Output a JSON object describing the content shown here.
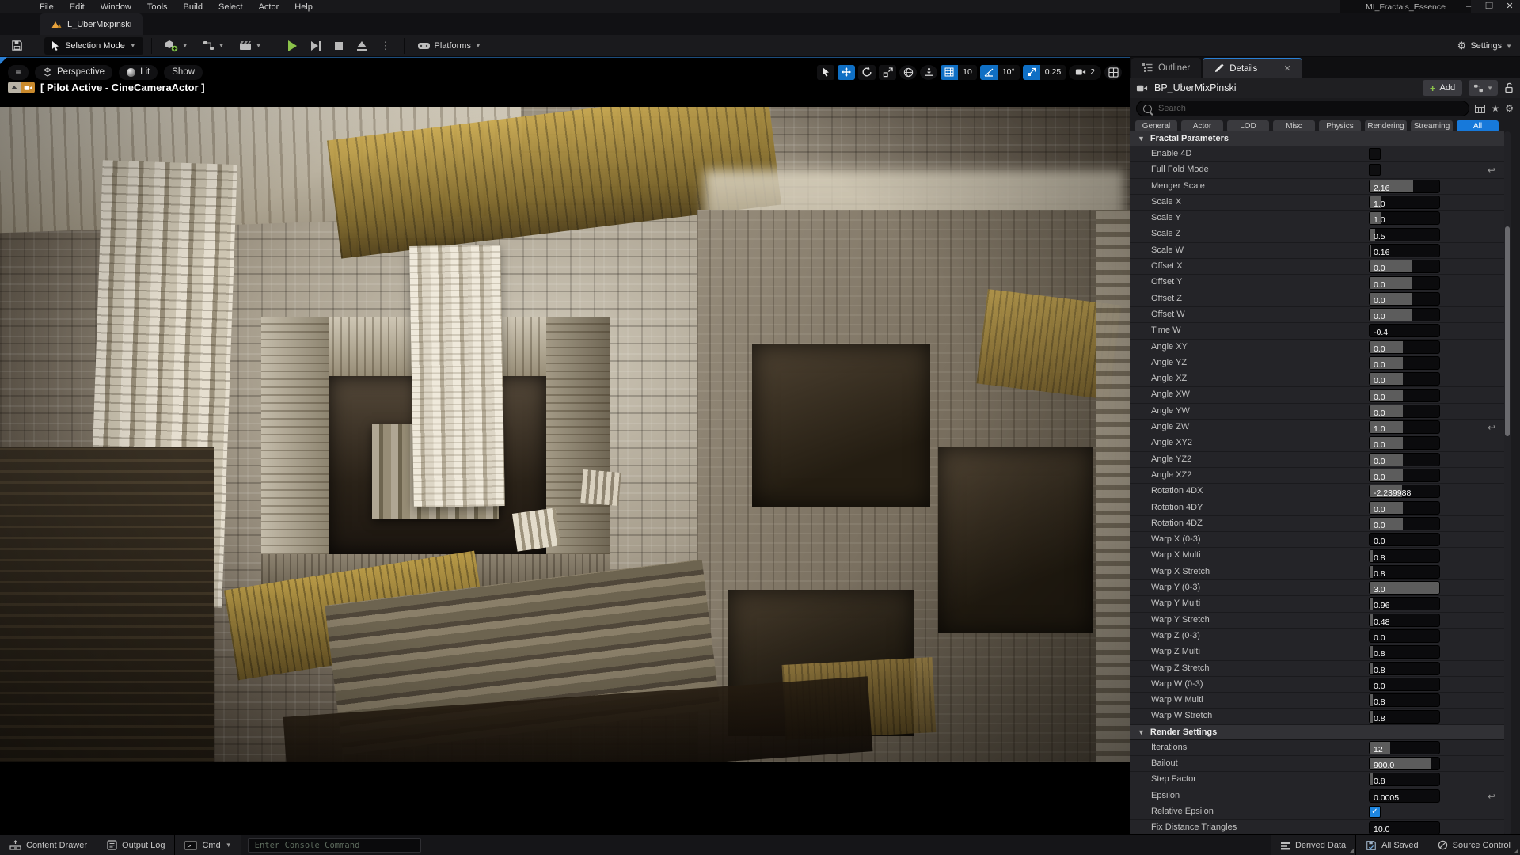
{
  "window": {
    "title": "MI_Fractals_Essence",
    "minimize": "–",
    "maximize": "❐",
    "close": "✕"
  },
  "menubar": {
    "menus": [
      "File",
      "Edit",
      "Window",
      "Tools",
      "Build",
      "Select",
      "Actor",
      "Help"
    ]
  },
  "level_tab": {
    "label": "L_UberMixpinski"
  },
  "toolbar": {
    "selection_mode": "Selection Mode",
    "platforms": "Platforms",
    "settings": "Settings"
  },
  "viewport": {
    "perspective": "Perspective",
    "lit": "Lit",
    "show": "Show",
    "pilot_label": "[ Pilot Active - CineCameraActor ]",
    "snaps": {
      "grid": "10",
      "rotation": "10°",
      "scale": "0.25",
      "camera_speed": "2"
    }
  },
  "details_panel": {
    "tabs": {
      "outliner": "Outliner",
      "details": "Details"
    },
    "object_name": "BP_UberMixPinski",
    "add_button": "Add",
    "search_placeholder": "Search",
    "filters": [
      "General",
      "Actor",
      "LOD",
      "Misc",
      "Physics",
      "Rendering",
      "Streaming",
      "All"
    ],
    "active_filter": "All",
    "sections": [
      {
        "title": "Fractal Parameters",
        "rows": [
          {
            "label": "Enable 4D",
            "type": "checkbox",
            "checked": false,
            "reset": false
          },
          {
            "label": "Full Fold Mode",
            "type": "checkbox",
            "checked": false,
            "reset": true
          },
          {
            "label": "Menger Scale",
            "type": "slider",
            "value": "2.16",
            "fill": 0.62,
            "reset": false
          },
          {
            "label": "Scale X",
            "type": "slider",
            "value": "1.0",
            "fill": 0.17,
            "reset": false
          },
          {
            "label": "Scale Y",
            "type": "slider",
            "value": "1.0",
            "fill": 0.17,
            "reset": false
          },
          {
            "label": "Scale Z",
            "type": "slider",
            "value": "0.5",
            "fill": 0.08,
            "reset": false
          },
          {
            "label": "Scale W",
            "type": "slider",
            "value": "0.16",
            "fill": 0.02,
            "reset": false
          },
          {
            "label": "Offset X",
            "type": "slider",
            "value": "0.0",
            "fill": 0.6,
            "reset": false
          },
          {
            "label": "Offset Y",
            "type": "slider",
            "value": "0.0",
            "fill": 0.6,
            "reset": false
          },
          {
            "label": "Offset Z",
            "type": "slider",
            "value": "0.0",
            "fill": 0.6,
            "reset": false
          },
          {
            "label": "Offset W",
            "type": "slider",
            "value": "0.0",
            "fill": 0.6,
            "reset": false
          },
          {
            "label": "Time W",
            "type": "slider",
            "value": "-0.4",
            "fill": 0,
            "reset": false
          },
          {
            "label": "Angle XY",
            "type": "slider",
            "value": "0.0",
            "fill": 0.48,
            "reset": false
          },
          {
            "label": "Angle YZ",
            "type": "slider",
            "value": "0.0",
            "fill": 0.48,
            "reset": false
          },
          {
            "label": "Angle XZ",
            "type": "slider",
            "value": "0.0",
            "fill": 0.48,
            "reset": false
          },
          {
            "label": "Angle XW",
            "type": "slider",
            "value": "0.0",
            "fill": 0.48,
            "reset": false
          },
          {
            "label": "Angle YW",
            "type": "slider",
            "value": "0.0",
            "fill": 0.48,
            "reset": false
          },
          {
            "label": "Angle ZW",
            "type": "slider",
            "value": "1.0",
            "fill": 0.48,
            "reset": true
          },
          {
            "label": "Angle XY2",
            "type": "slider",
            "value": "0.0",
            "fill": 0.48,
            "reset": false
          },
          {
            "label": "Angle YZ2",
            "type": "slider",
            "value": "0.0",
            "fill": 0.48,
            "reset": false
          },
          {
            "label": "Angle XZ2",
            "type": "slider",
            "value": "0.0",
            "fill": 0.48,
            "reset": false
          },
          {
            "label": "Rotation 4DX",
            "type": "slider",
            "value": "-2.239988",
            "fill": 0.47,
            "reset": false
          },
          {
            "label": "Rotation 4DY",
            "type": "slider",
            "value": "0.0",
            "fill": 0.48,
            "reset": false
          },
          {
            "label": "Rotation 4DZ",
            "type": "slider",
            "value": "0.0",
            "fill": 0.48,
            "reset": false
          },
          {
            "label": "Warp X (0-3)",
            "type": "slider",
            "value": "0.0",
            "fill": 0,
            "reset": false
          },
          {
            "label": "Warp X Multi",
            "type": "slider",
            "value": "0.8",
            "fill": 0.04,
            "reset": false
          },
          {
            "label": "Warp X Stretch",
            "type": "slider",
            "value": "0.8",
            "fill": 0.04,
            "reset": false
          },
          {
            "label": "Warp Y (0-3)",
            "type": "slider",
            "value": "3.0",
            "fill": 1,
            "reset": false
          },
          {
            "label": "Warp Y Multi",
            "type": "slider",
            "value": "0.96",
            "fill": 0.04,
            "reset": false
          },
          {
            "label": "Warp Y Stretch",
            "type": "slider",
            "value": "0.48",
            "fill": 0.04,
            "reset": false
          },
          {
            "label": "Warp Z (0-3)",
            "type": "slider",
            "value": "0.0",
            "fill": 0,
            "reset": false
          },
          {
            "label": "Warp Z Multi",
            "type": "slider",
            "value": "0.8",
            "fill": 0.04,
            "reset": false
          },
          {
            "label": "Warp Z Stretch",
            "type": "slider",
            "value": "0.8",
            "fill": 0.04,
            "reset": false
          },
          {
            "label": "Warp W (0-3)",
            "type": "slider",
            "value": "0.0",
            "fill": 0,
            "reset": false
          },
          {
            "label": "Warp W Multi",
            "type": "slider",
            "value": "0.8",
            "fill": 0.04,
            "reset": false
          },
          {
            "label": "Warp W Stretch",
            "type": "slider",
            "value": "0.8",
            "fill": 0.04,
            "reset": false
          }
        ]
      },
      {
        "title": "Render Settings",
        "rows": [
          {
            "label": "Iterations",
            "type": "slider",
            "value": "12",
            "fill": 0.3,
            "reset": false
          },
          {
            "label": "Bailout",
            "type": "slider",
            "value": "900.0",
            "fill": 0.88,
            "reset": false
          },
          {
            "label": "Step Factor",
            "type": "slider",
            "value": "0.8",
            "fill": 0.04,
            "reset": false
          },
          {
            "label": "Epsilon",
            "type": "slider",
            "value": "0.0005",
            "fill": 0,
            "reset": true
          },
          {
            "label": "Relative Epsilon",
            "type": "checkbox",
            "checked": true,
            "reset": false
          },
          {
            "label": "Fix Distance Triangles",
            "type": "slider",
            "value": "10.0",
            "fill": 0,
            "reset": false
          }
        ]
      }
    ]
  },
  "statusbar": {
    "content_drawer": "Content Drawer",
    "output_log": "Output Log",
    "cmd": "Cmd",
    "console_placeholder": "Enter Console Command",
    "derived_data": "Derived Data",
    "all_saved": "All Saved",
    "source_control": "Source Control"
  },
  "colors": {
    "accent_blue": "#1779da",
    "tool_blue": "#0f6fc4",
    "green": "#8bc24a",
    "orange": "#e8a33d",
    "checkbox_blue": "#1e86e0"
  }
}
